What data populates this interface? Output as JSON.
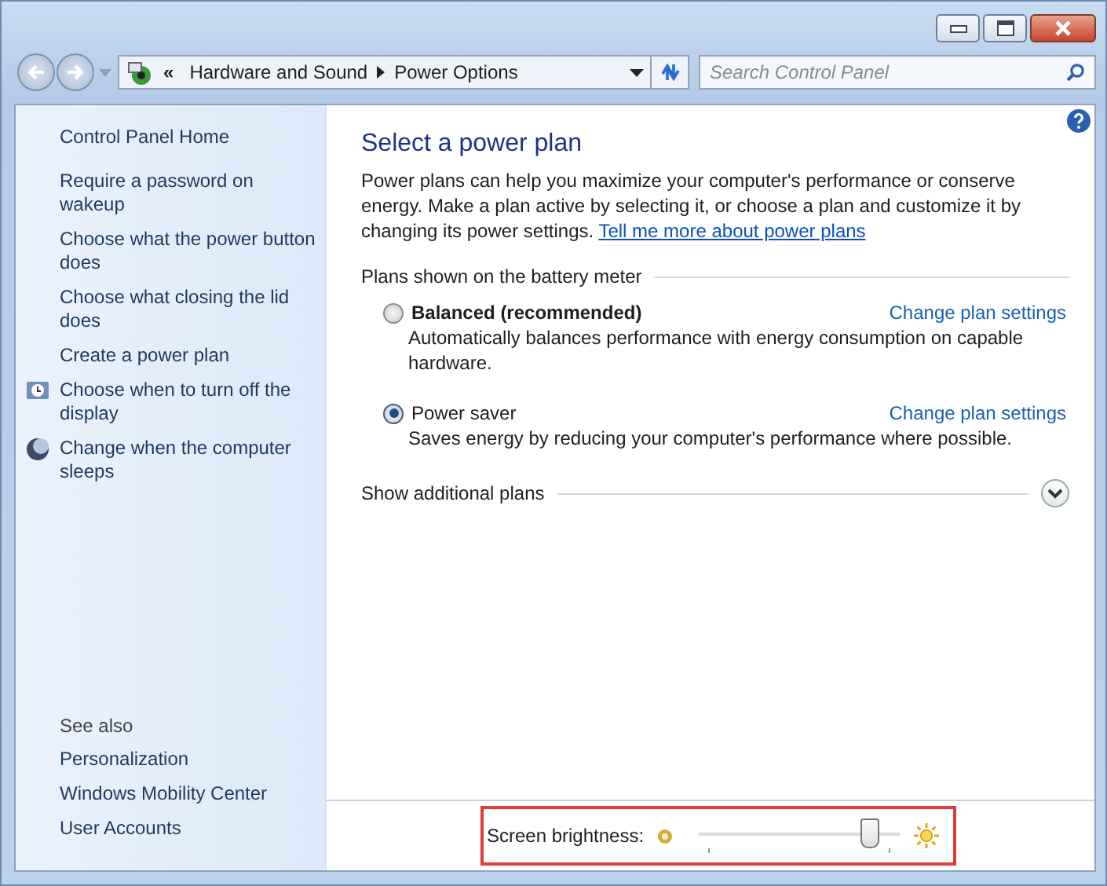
{
  "address_bar": {
    "overflow": "«",
    "crumbs": [
      "Hardware and Sound",
      "Power Options"
    ]
  },
  "search": {
    "placeholder": "Search Control Panel"
  },
  "sidebar": {
    "home": "Control Panel Home",
    "items": [
      {
        "label": "Require a password on wakeup",
        "kind": "link"
      },
      {
        "label": "Choose what the power button does",
        "kind": "link"
      },
      {
        "label": "Choose what closing the lid does",
        "kind": "link"
      },
      {
        "label": "Create a power plan",
        "kind": "link"
      },
      {
        "label": "Choose when to turn off the display",
        "kind": "display"
      },
      {
        "label": "Change when the computer sleeps",
        "kind": "sleep"
      }
    ],
    "see_also": {
      "heading": "See also",
      "items": [
        "Personalization",
        "Windows Mobility Center",
        "User Accounts"
      ]
    }
  },
  "main": {
    "title": "Select a power plan",
    "intro": "Power plans can help you maximize your computer's performance or conserve energy. Make a plan active by selecting it, or choose a plan and customize it by changing its power settings.",
    "intro_link": "Tell me more about power plans",
    "group_label": "Plans shown on the battery meter",
    "plans": [
      {
        "name": "Balanced (recommended)",
        "bold": true,
        "selected": false,
        "link": "Change plan settings",
        "description": "Automatically balances performance with energy consumption on capable hardware."
      },
      {
        "name": "Power saver",
        "bold": false,
        "selected": true,
        "link": "Change plan settings",
        "description": "Saves energy by reducing your computer's performance where possible."
      }
    ],
    "more": "Show additional plans"
  },
  "brightness": {
    "label": "Screen brightness:",
    "level": 0.84
  }
}
